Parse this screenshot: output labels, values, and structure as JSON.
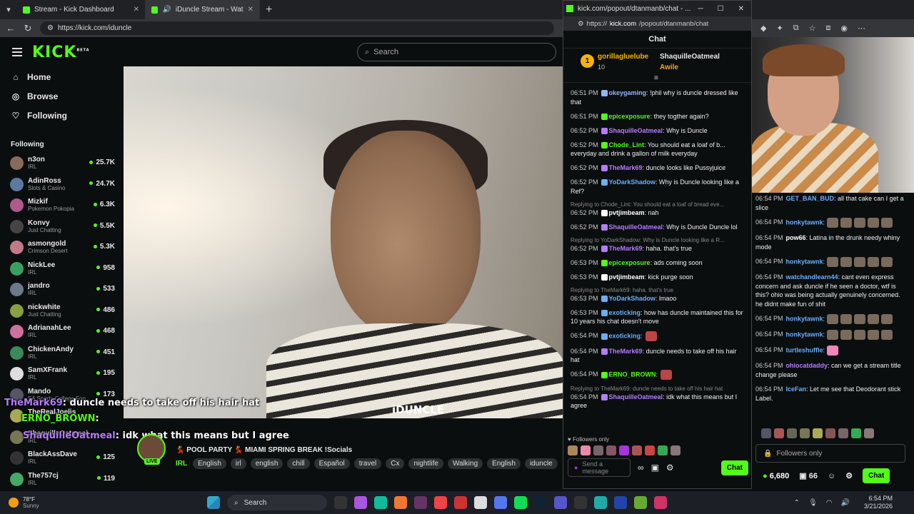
{
  "browser": {
    "tabs": [
      {
        "title": "Stream - Kick Dashboard"
      },
      {
        "title": "iDuncle Stream - Watch Live o"
      }
    ],
    "url": "https://kick.com/iduncle"
  },
  "kick": {
    "logo": "KICK",
    "beta": "BETA",
    "search_placeholder": "Search",
    "nav": [
      {
        "label": "Home",
        "icon": "home-icon"
      },
      {
        "label": "Browse",
        "icon": "compass-icon"
      },
      {
        "label": "Following",
        "icon": "heart-icon"
      }
    ],
    "following_title": "Following",
    "following": [
      {
        "name": "n3on",
        "cat": "IRL",
        "viewers": "25.7K",
        "color": "#8a6a5a"
      },
      {
        "name": "AdinRoss",
        "cat": "Slots & Casino",
        "viewers": "24.7K",
        "color": "#5a7aa0"
      },
      {
        "name": "Mizkif",
        "cat": "Pokemon Pokopia",
        "viewers": "6.3K",
        "color": "#b05a8a"
      },
      {
        "name": "Konvy",
        "cat": "Just Chatting",
        "viewers": "5.5K",
        "color": "#444"
      },
      {
        "name": "asmongold",
        "cat": "Crimson Desert",
        "viewers": "5.3K",
        "color": "#c07a8a"
      },
      {
        "name": "NickLee",
        "cat": "IRL",
        "viewers": "958",
        "color": "#3aa060"
      },
      {
        "name": "jandro",
        "cat": "IRL",
        "viewers": "533",
        "color": "#6a7a8a"
      },
      {
        "name": "nickwhite",
        "cat": "Just Chatting",
        "viewers": "486",
        "color": "#8aa040"
      },
      {
        "name": "AdrianahLee",
        "cat": "IRL",
        "viewers": "468",
        "color": "#d070a0"
      },
      {
        "name": "ChickenAndy",
        "cat": "IRL",
        "viewers": "451",
        "color": "#3a8a5a"
      },
      {
        "name": "SamXFrank",
        "cat": "IRL",
        "viewers": "195",
        "color": "#ddd"
      },
      {
        "name": "Mando",
        "cat": "EA Sports College Foo...",
        "viewers": "173",
        "color": "#556"
      },
      {
        "name": "TheRealJoelis",
        "cat": "IRL",
        "viewers": "",
        "color": "#aa5"
      },
      {
        "name": "ShaquilleOatmeal",
        "cat": "IRL",
        "viewers": "",
        "color": "#775"
      },
      {
        "name": "BlackAssDave",
        "cat": "IRL",
        "viewers": "125",
        "color": "#333"
      },
      {
        "name": "The757cj",
        "cat": "IRL",
        "viewers": "119",
        "color": "#4a6"
      }
    ],
    "video": {
      "overlay_text": "iDUNCLE",
      "chat_lines": [
        {
          "user": "TheMark69",
          "text": ": duncle needs to take off his hair hat",
          "color": "#b57cff"
        },
        {
          "user": "ERNO_BROWN",
          "text": ":",
          "color": "#53fc18"
        },
        {
          "user": "ShaquilleOatmeal",
          "text": ": idk what this means but I agree",
          "color": "#b57cff"
        }
      ]
    },
    "stream": {
      "title": "💃 POOL PARTY 💃 MIAMI SPRING BREAK !Socials",
      "live": "LIVE",
      "category": "IRL",
      "tags": [
        "English",
        "irl",
        "english",
        "chill",
        "Español",
        "travel",
        "Cx",
        "nightlife",
        "Walking",
        "English",
        "iduncle"
      ]
    }
  },
  "popup": {
    "title": "kick.com/popout/dtanmanb/chat - ...",
    "url_prefix": "https://",
    "url_host": "kick.com",
    "url_path": "/popout/dtanmanb/chat",
    "chat_title": "Chat",
    "pinned": {
      "rank": "1",
      "user": "gorillagluelube",
      "count": "10",
      "user2": "ShaquilleOatmeal",
      "label2": "Awile"
    },
    "messages": [
      {
        "time": "06:51 PM",
        "user": "okeygaming",
        "color": "#8fb8ff",
        "text": ": !phil why is duncle dressed like that",
        "reply": ""
      },
      {
        "time": "06:51 PM",
        "user": "epicexposure",
        "color": "#53fc18",
        "text": ": they togther again?",
        "reply": ""
      },
      {
        "time": "06:52 PM",
        "user": "ShaquilleOatmeal",
        "color": "#b57cff",
        "text": ": Why is Duncle",
        "reply": ""
      },
      {
        "time": "06:52 PM",
        "user": "Chode_Lint",
        "color": "#53fc18",
        "text": ": You should eat a loaf of b... everyday and drink a gallon of milk everyday",
        "reply": ""
      },
      {
        "time": "06:52 PM",
        "user": "TheMark69",
        "color": "#b57cff",
        "text": ": duncle looks like Pussyjuice",
        "reply": ""
      },
      {
        "time": "06:52 PM",
        "user": "YoDarkShadow",
        "color": "#6aaeff",
        "text": ": Why is Duncle looking like a Ref?",
        "reply": ""
      },
      {
        "time": "06:52 PM",
        "user": "pvtjimbeam",
        "color": "#ffffff",
        "text": ": nah",
        "reply": "Replying to Chode_Lint: You should eat a loaf of bread eve..."
      },
      {
        "time": "06:52 PM",
        "user": "ShaquilleOatmeal",
        "color": "#b57cff",
        "text": ": Why is Duncle Duncle lol",
        "reply": ""
      },
      {
        "time": "06:52 PM",
        "user": "TheMark69",
        "color": "#b57cff",
        "text": ": haha. that's true",
        "reply": "Replying to YoDarkShadow: Why is Duncle looking like a R..."
      },
      {
        "time": "06:53 PM",
        "user": "epicexposure",
        "color": "#53fc18",
        "text": ": ads coming soon",
        "reply": ""
      },
      {
        "time": "06:53 PM",
        "user": "pvtjimbeam",
        "color": "#ffffff",
        "text": ": kick purge soon",
        "reply": ""
      },
      {
        "time": "06:53 PM",
        "user": "YoDarkShadow",
        "color": "#6aaeff",
        "text": ": lmaoo",
        "reply": "Replying to TheMark69: haha. that's true"
      },
      {
        "time": "06:53 PM",
        "user": "exoticking",
        "color": "#6aaeff",
        "text": ": how has duncle maintained this for 10 years his chat doesn't move",
        "reply": ""
      },
      {
        "time": "06:54 PM",
        "user": "exoticking",
        "color": "#6aaeff",
        "text": ":",
        "reply": ""
      },
      {
        "time": "06:54 PM",
        "user": "TheMark69",
        "color": "#b57cff",
        "text": ": duncle needs to take off his hair hat",
        "reply": ""
      },
      {
        "time": "06:54 PM",
        "user": "ERNO_BROWN",
        "color": "#53fc18",
        "text": ":",
        "reply": ""
      },
      {
        "time": "06:54 PM",
        "user": "ShaquilleOatmeal",
        "color": "#b57cff",
        "text": ": idk what this means but I agree",
        "reply": "Replying to TheMark69: duncle needs to take off his hair hat"
      }
    ],
    "followers_only": "Followers only",
    "send_placeholder": "Send a message",
    "chat_button": "Chat"
  },
  "right": {
    "messages": [
      {
        "time": "06:54 PM",
        "user": "GET_BAN_BUD",
        "color": "#6aaeff",
        "text": ": all that cake can I get a slice"
      },
      {
        "time": "06:54 PM",
        "user": "honkytawnk",
        "color": "#6aaeff",
        "text": ":"
      },
      {
        "time": "06:54 PM",
        "user": "pow66",
        "color": "#ffffff",
        "text": ": Latina in the drunk needy whiny mode"
      },
      {
        "time": "06:54 PM",
        "user": "honkytawnk",
        "color": "#6aaeff",
        "text": ":"
      },
      {
        "time": "06:54 PM",
        "user": "watchandlearn44",
        "color": "#6aaeff",
        "text": ": cant even express concern and ask duncle if he seen a doctor, wtf is this? ohio was being actually genuinely concerned. he didnt make fun of shit"
      },
      {
        "time": "06:54 PM",
        "user": "honkytawnk",
        "color": "#6aaeff",
        "text": ":"
      },
      {
        "time": "06:54 PM",
        "user": "honkytawnk",
        "color": "#6aaeff",
        "text": ":"
      },
      {
        "time": "06:54 PM",
        "user": "turtleshuffle",
        "color": "#6aaeff",
        "text": ":"
      },
      {
        "time": "06:54 PM",
        "user": "ohiocatdaddy",
        "color": "#b57cff",
        "text": ": can we get a stream title change please"
      },
      {
        "time": "06:54 PM",
        "user": "IceFan",
        "color": "#6aaeff",
        "text": ": Let me see that Deodorant stick Label."
      }
    ],
    "followers_only": "Followers only",
    "points": "6,680",
    "count": "66",
    "chat_button": "Chat"
  },
  "taskbar": {
    "temp": "78°F",
    "weather": "Sunny",
    "search": "Search",
    "time": "6:54 PM",
    "date": "3/21/2026"
  },
  "colors": {
    "accent": "#53fc18"
  }
}
